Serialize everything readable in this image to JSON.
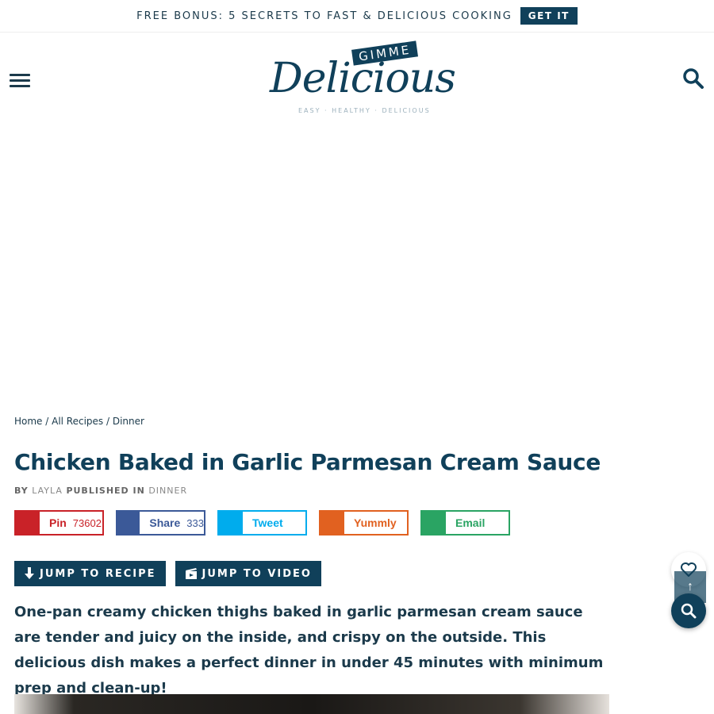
{
  "topbar": {
    "text": "FREE BONUS: 5 SECRETS TO FAST & DELICIOUS COOKING",
    "button": "GET IT"
  },
  "logo": {
    "badge": "GIMME",
    "script": "Delicious",
    "tagline": "EASY · HEALTHY · DELICIOUS"
  },
  "breadcrumb": {
    "items": [
      "Home",
      "All Recipes",
      "Dinner"
    ],
    "separator": " / "
  },
  "post": {
    "title": "Chicken Baked in Garlic Parmesan Cream Sauce",
    "by_label": "BY",
    "author": "LAYLA",
    "published_label": "PUBLISHED IN",
    "category": "DINNER",
    "intro": "One-pan creamy chicken thighs baked in garlic parmesan cream sauce are tender and juicy on the inside, and crispy on the outside. This delicious dish makes a perfect dinner in under 45 minutes with minimum prep and clean-up!"
  },
  "share": [
    {
      "label": "Pin",
      "count": "73602",
      "color": "#c92228"
    },
    {
      "label": "Share",
      "count": "333",
      "color": "#3b5998"
    },
    {
      "label": "Tweet",
      "count": "",
      "color": "#00aced"
    },
    {
      "label": "Yummly",
      "count": "",
      "color": "#e16120"
    },
    {
      "label": "Email",
      "count": "",
      "color": "#2aa463"
    }
  ],
  "jump": {
    "recipe": "JUMP TO RECIPE",
    "video": "JUMP TO VIDEO"
  },
  "icons": {
    "menu": "hamburger-icon",
    "search": "search-icon",
    "heart": "heart-icon",
    "up": "arrow-up-icon"
  },
  "colors": {
    "brand": "#10405a"
  }
}
